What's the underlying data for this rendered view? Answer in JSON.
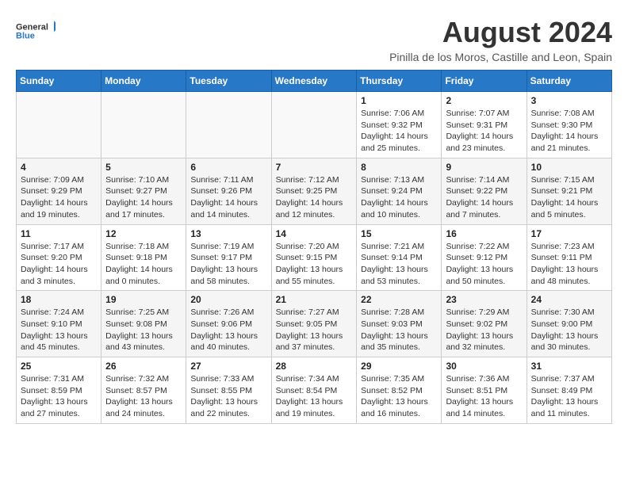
{
  "header": {
    "logo_line1": "General",
    "logo_line2": "Blue",
    "month_year": "August 2024",
    "location": "Pinilla de los Moros, Castille and Leon, Spain"
  },
  "weekdays": [
    "Sunday",
    "Monday",
    "Tuesday",
    "Wednesday",
    "Thursday",
    "Friday",
    "Saturday"
  ],
  "weeks": [
    [
      {
        "day": "",
        "sunrise": "",
        "sunset": "",
        "daylight": ""
      },
      {
        "day": "",
        "sunrise": "",
        "sunset": "",
        "daylight": ""
      },
      {
        "day": "",
        "sunrise": "",
        "sunset": "",
        "daylight": ""
      },
      {
        "day": "",
        "sunrise": "",
        "sunset": "",
        "daylight": ""
      },
      {
        "day": "1",
        "sunrise": "Sunrise: 7:06 AM",
        "sunset": "Sunset: 9:32 PM",
        "daylight": "Daylight: 14 hours and 25 minutes."
      },
      {
        "day": "2",
        "sunrise": "Sunrise: 7:07 AM",
        "sunset": "Sunset: 9:31 PM",
        "daylight": "Daylight: 14 hours and 23 minutes."
      },
      {
        "day": "3",
        "sunrise": "Sunrise: 7:08 AM",
        "sunset": "Sunset: 9:30 PM",
        "daylight": "Daylight: 14 hours and 21 minutes."
      }
    ],
    [
      {
        "day": "4",
        "sunrise": "Sunrise: 7:09 AM",
        "sunset": "Sunset: 9:29 PM",
        "daylight": "Daylight: 14 hours and 19 minutes."
      },
      {
        "day": "5",
        "sunrise": "Sunrise: 7:10 AM",
        "sunset": "Sunset: 9:27 PM",
        "daylight": "Daylight: 14 hours and 17 minutes."
      },
      {
        "day": "6",
        "sunrise": "Sunrise: 7:11 AM",
        "sunset": "Sunset: 9:26 PM",
        "daylight": "Daylight: 14 hours and 14 minutes."
      },
      {
        "day": "7",
        "sunrise": "Sunrise: 7:12 AM",
        "sunset": "Sunset: 9:25 PM",
        "daylight": "Daylight: 14 hours and 12 minutes."
      },
      {
        "day": "8",
        "sunrise": "Sunrise: 7:13 AM",
        "sunset": "Sunset: 9:24 PM",
        "daylight": "Daylight: 14 hours and 10 minutes."
      },
      {
        "day": "9",
        "sunrise": "Sunrise: 7:14 AM",
        "sunset": "Sunset: 9:22 PM",
        "daylight": "Daylight: 14 hours and 7 minutes."
      },
      {
        "day": "10",
        "sunrise": "Sunrise: 7:15 AM",
        "sunset": "Sunset: 9:21 PM",
        "daylight": "Daylight: 14 hours and 5 minutes."
      }
    ],
    [
      {
        "day": "11",
        "sunrise": "Sunrise: 7:17 AM",
        "sunset": "Sunset: 9:20 PM",
        "daylight": "Daylight: 14 hours and 3 minutes."
      },
      {
        "day": "12",
        "sunrise": "Sunrise: 7:18 AM",
        "sunset": "Sunset: 9:18 PM",
        "daylight": "Daylight: 14 hours and 0 minutes."
      },
      {
        "day": "13",
        "sunrise": "Sunrise: 7:19 AM",
        "sunset": "Sunset: 9:17 PM",
        "daylight": "Daylight: 13 hours and 58 minutes."
      },
      {
        "day": "14",
        "sunrise": "Sunrise: 7:20 AM",
        "sunset": "Sunset: 9:15 PM",
        "daylight": "Daylight: 13 hours and 55 minutes."
      },
      {
        "day": "15",
        "sunrise": "Sunrise: 7:21 AM",
        "sunset": "Sunset: 9:14 PM",
        "daylight": "Daylight: 13 hours and 53 minutes."
      },
      {
        "day": "16",
        "sunrise": "Sunrise: 7:22 AM",
        "sunset": "Sunset: 9:12 PM",
        "daylight": "Daylight: 13 hours and 50 minutes."
      },
      {
        "day": "17",
        "sunrise": "Sunrise: 7:23 AM",
        "sunset": "Sunset: 9:11 PM",
        "daylight": "Daylight: 13 hours and 48 minutes."
      }
    ],
    [
      {
        "day": "18",
        "sunrise": "Sunrise: 7:24 AM",
        "sunset": "Sunset: 9:10 PM",
        "daylight": "Daylight: 13 hours and 45 minutes."
      },
      {
        "day": "19",
        "sunrise": "Sunrise: 7:25 AM",
        "sunset": "Sunset: 9:08 PM",
        "daylight": "Daylight: 13 hours and 43 minutes."
      },
      {
        "day": "20",
        "sunrise": "Sunrise: 7:26 AM",
        "sunset": "Sunset: 9:06 PM",
        "daylight": "Daylight: 13 hours and 40 minutes."
      },
      {
        "day": "21",
        "sunrise": "Sunrise: 7:27 AM",
        "sunset": "Sunset: 9:05 PM",
        "daylight": "Daylight: 13 hours and 37 minutes."
      },
      {
        "day": "22",
        "sunrise": "Sunrise: 7:28 AM",
        "sunset": "Sunset: 9:03 PM",
        "daylight": "Daylight: 13 hours and 35 minutes."
      },
      {
        "day": "23",
        "sunrise": "Sunrise: 7:29 AM",
        "sunset": "Sunset: 9:02 PM",
        "daylight": "Daylight: 13 hours and 32 minutes."
      },
      {
        "day": "24",
        "sunrise": "Sunrise: 7:30 AM",
        "sunset": "Sunset: 9:00 PM",
        "daylight": "Daylight: 13 hours and 30 minutes."
      }
    ],
    [
      {
        "day": "25",
        "sunrise": "Sunrise: 7:31 AM",
        "sunset": "Sunset: 8:59 PM",
        "daylight": "Daylight: 13 hours and 27 minutes."
      },
      {
        "day": "26",
        "sunrise": "Sunrise: 7:32 AM",
        "sunset": "Sunset: 8:57 PM",
        "daylight": "Daylight: 13 hours and 24 minutes."
      },
      {
        "day": "27",
        "sunrise": "Sunrise: 7:33 AM",
        "sunset": "Sunset: 8:55 PM",
        "daylight": "Daylight: 13 hours and 22 minutes."
      },
      {
        "day": "28",
        "sunrise": "Sunrise: 7:34 AM",
        "sunset": "Sunset: 8:54 PM",
        "daylight": "Daylight: 13 hours and 19 minutes."
      },
      {
        "day": "29",
        "sunrise": "Sunrise: 7:35 AM",
        "sunset": "Sunset: 8:52 PM",
        "daylight": "Daylight: 13 hours and 16 minutes."
      },
      {
        "day": "30",
        "sunrise": "Sunrise: 7:36 AM",
        "sunset": "Sunset: 8:51 PM",
        "daylight": "Daylight: 13 hours and 14 minutes."
      },
      {
        "day": "31",
        "sunrise": "Sunrise: 7:37 AM",
        "sunset": "Sunset: 8:49 PM",
        "daylight": "Daylight: 13 hours and 11 minutes."
      }
    ]
  ]
}
